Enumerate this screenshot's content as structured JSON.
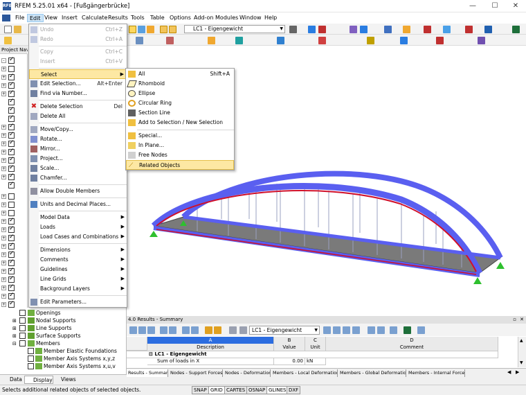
{
  "window": {
    "title": "RFEM 5.25.01 x64 - [Fußgängerbrücke]",
    "logo_text": "RFEM"
  },
  "menubar": [
    "File",
    "Edit",
    "View",
    "Insert",
    "Calculate",
    "Results",
    "Tools",
    "Table",
    "Options",
    "Add-on Modules",
    "Window",
    "Help"
  ],
  "toolbar": {
    "load_case": "LC1 - Eigengewicht"
  },
  "nav": {
    "header": "Project Nav"
  },
  "edit_menu": {
    "undo": {
      "label": "Undo",
      "shortcut": "Ctrl+Z"
    },
    "redo": {
      "label": "Redo",
      "shortcut": "Ctrl+A"
    },
    "copy": {
      "label": "Copy",
      "shortcut": "Ctrl+C"
    },
    "insert": {
      "label": "Insert",
      "shortcut": "Ctrl+V"
    },
    "select": "Select",
    "edit_selection": {
      "label": "Edit Selection...",
      "shortcut": "Alt+Enter"
    },
    "find_number": "Find via Number...",
    "delete_selection": {
      "label": "Delete Selection",
      "shortcut": "Del"
    },
    "delete_all": "Delete All",
    "move_copy": "Move/Copy...",
    "rotate": "Rotate...",
    "mirror": "Mirror...",
    "project": "Project...",
    "scale": "Scale...",
    "chamfer": "Chamfer...",
    "allow_double": "Allow Double Members",
    "units": "Units and Decimal Places...",
    "model_data": "Model Data",
    "loads": "Loads",
    "load_cases": "Load Cases and Combinations",
    "dimensions": "Dimensions",
    "comments": "Comments",
    "guidelines": "Guidelines",
    "line_grids": "Line Grids",
    "background_layers": "Background Layers",
    "edit_parameters": "Edit Parameters..."
  },
  "select_submenu": {
    "all": {
      "label": "All",
      "shortcut": "Shift+A"
    },
    "rhomboid": "Rhomboid",
    "ellipse": "Ellipse",
    "circular_ring": "Circular Ring",
    "section_line": "Section Line",
    "add_to_selection": "Add to Selection / New Selection",
    "special": "Special...",
    "in_plane": "In Plane...",
    "free_nodes": "Free Nodes",
    "related_objects": "Related Objects"
  },
  "nav_tree": [
    "Openings",
    "Nodal Supports",
    "Line Supports",
    "Surface Supports",
    "Members",
    "Member Elastic Foundations",
    "Member Axis Systems x,y,z",
    "Member Axis Systems x,u,v"
  ],
  "nav_tabs": [
    "Data",
    "Display",
    "Views"
  ],
  "results": {
    "header": "4.0 Results - Summary",
    "load_case": "LC1 - Eigengewicht",
    "col_letters": [
      "A",
      "B",
      "C",
      "D"
    ],
    "col_names": [
      "Description",
      "Value",
      "Unit",
      "Comment"
    ],
    "group": "LC1 - Eigengewicht",
    "row": {
      "desc": "Sum of loads in X",
      "value": "0.00",
      "unit": "kN"
    }
  },
  "result_tabs": [
    "Results - Summary",
    "Nodes - Support Forces",
    "Nodes - Deformations",
    "Members - Local Deformations",
    "Members - Global Deformations",
    "Members - Internal Forces"
  ],
  "status": {
    "text": "Selects additional related objects of selected objects.",
    "buttons": [
      "SNAP",
      "GRID",
      "CARTES",
      "OSNAP",
      "GLINES",
      "DXF"
    ]
  },
  "colors": {
    "arch": "#5a5ff0",
    "highlight": "#fde8a3",
    "support": "#2ec02e",
    "red_member": "#d0102a"
  }
}
